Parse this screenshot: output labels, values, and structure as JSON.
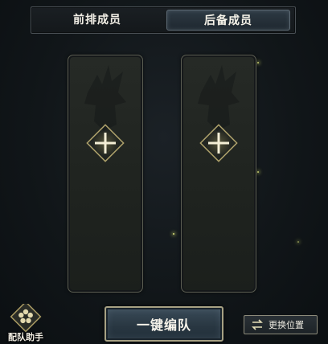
{
  "tabs": {
    "front_label": "前排成员",
    "back_label": "后备成员",
    "active": "back"
  },
  "slots": [
    {
      "state": "empty",
      "icon": "plus-icon"
    },
    {
      "state": "empty",
      "icon": "plus-icon"
    }
  ],
  "bottom": {
    "helper_label": "配队助手",
    "auto_team_label": "一键编队",
    "swap_label": "更换位置"
  },
  "colors": {
    "accent_gold": "#d9c98a",
    "panel_border": "#5b5d52",
    "active_tab": "#2d3943"
  }
}
